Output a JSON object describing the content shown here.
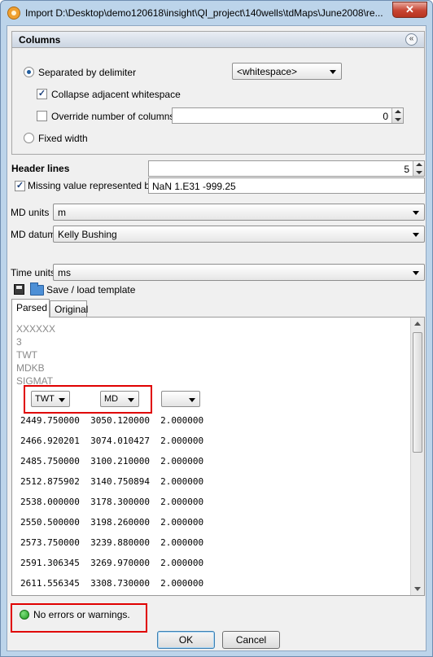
{
  "window": {
    "title": "Import D:\\Desktop\\demo120618\\insight\\QI_project\\140wells\\tdMaps\\June2008\\re...",
    "close_label": "✕"
  },
  "columns_group": {
    "title": "Columns",
    "collapse_label": "«",
    "separated_by_delimiter_label": "Separated by delimiter",
    "separated_by_delimiter_selected": true,
    "delimiter_value": "<whitespace>",
    "collapse_whitespace_label": "Collapse adjacent whitespace",
    "collapse_whitespace_checked": true,
    "override_columns_label": "Override number of columns",
    "override_columns_checked": false,
    "override_columns_value": "0",
    "fixed_width_label": "Fixed width",
    "fixed_width_selected": false
  },
  "header_lines": {
    "label": "Header lines",
    "value": "5"
  },
  "missing_value": {
    "label": "Missing value represented by",
    "checked": true,
    "value": "NaN 1.E31 -999.25"
  },
  "md_units": {
    "label": "MD units",
    "value": "m"
  },
  "md_datum": {
    "label": "MD datum",
    "value": "Kelly Bushing"
  },
  "time_units": {
    "label": "Time units",
    "value": "ms"
  },
  "template": {
    "label": "Save / load template"
  },
  "tabs": [
    {
      "label": "Parsed",
      "active": true
    },
    {
      "label": "Original",
      "active": false
    }
  ],
  "preview": {
    "header_lines": [
      "XXXXXX",
      "3",
      "TWT",
      "MDKB",
      "SIGMAT"
    ],
    "column_types": [
      "TWT",
      "MD",
      ""
    ],
    "rows": [
      "2449.750000  3050.120000  2.000000",
      "2466.920201  3074.010427  2.000000",
      "2485.750000  3100.210000  2.000000",
      "2512.875902  3140.750894  2.000000",
      "2538.000000  3178.300000  2.000000",
      "2550.500000  3198.260000  2.000000",
      "2573.750000  3239.880000  2.000000",
      "2591.306345  3269.970000  2.000000",
      "2611.556345  3308.730000  2.000000"
    ]
  },
  "status": {
    "text": "No errors or warnings.",
    "color": "#1f9a1f"
  },
  "buttons": {
    "ok": "OK",
    "cancel": "Cancel"
  },
  "colors": {
    "highlight_box": "#e00000",
    "window_frame": "#bcd4ea"
  }
}
